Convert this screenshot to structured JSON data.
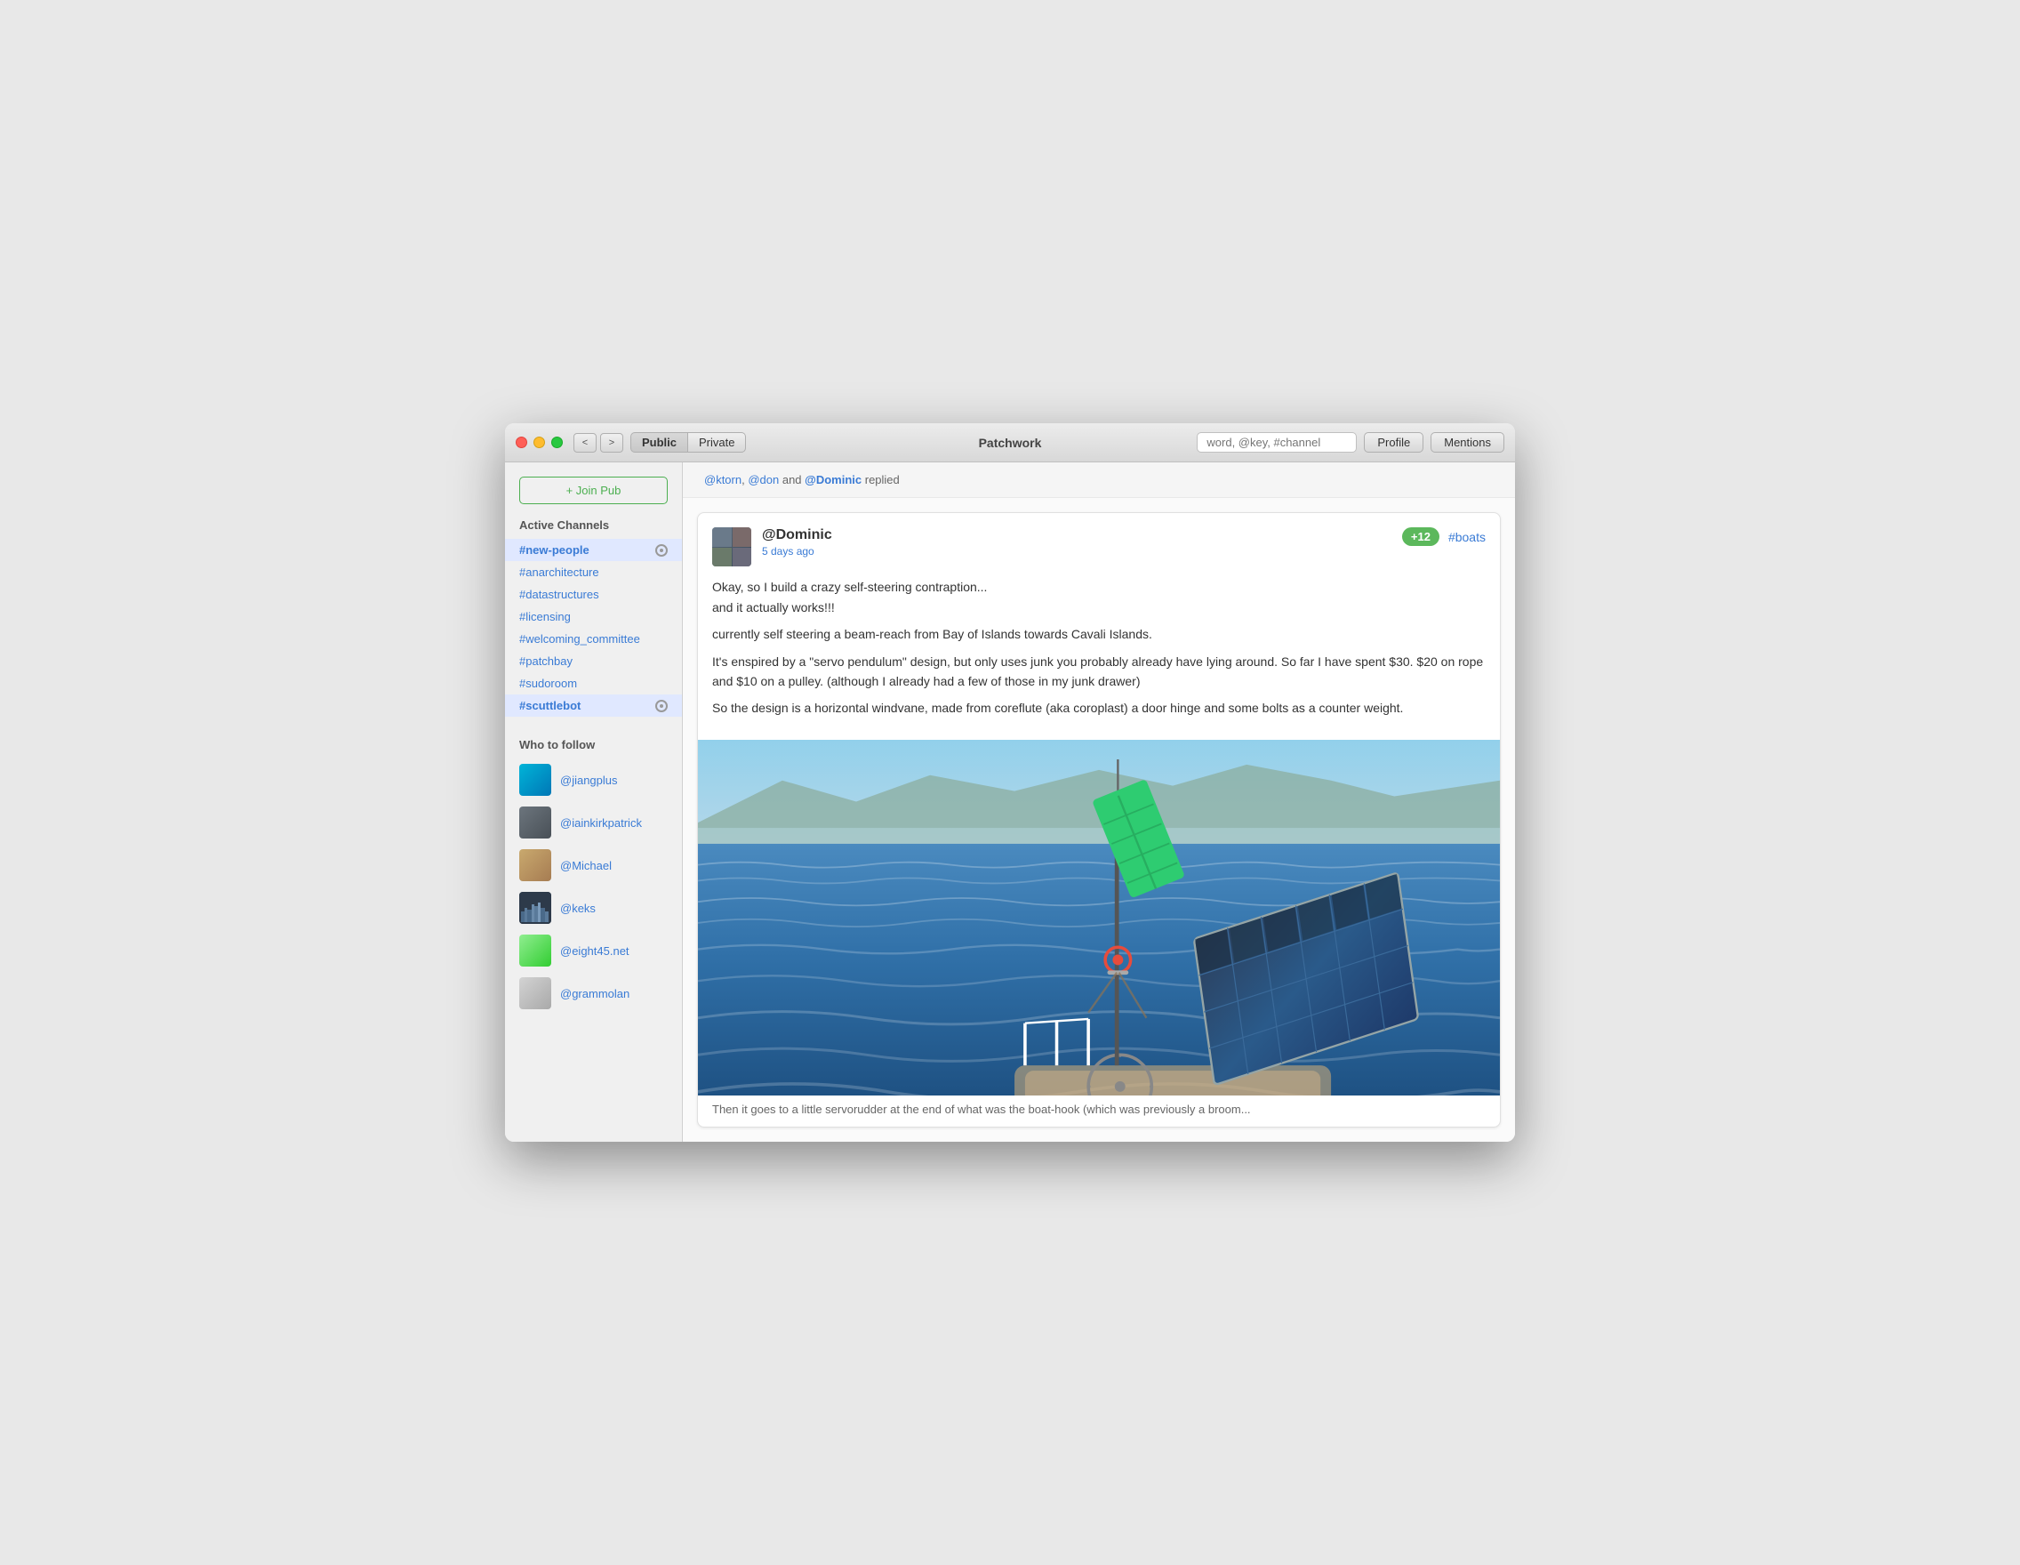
{
  "window": {
    "title": "Patchwork"
  },
  "titlebar": {
    "back_label": "<",
    "forward_label": ">",
    "view_public_label": "Public",
    "view_private_label": "Private",
    "search_placeholder": "word, @key, #channel",
    "profile_label": "Profile",
    "mentions_label": "Mentions"
  },
  "sidebar": {
    "join_pub_label": "+ Join Pub",
    "active_channels_title": "Active Channels",
    "channels": [
      {
        "name": "#new-people",
        "active": true,
        "has_indicator": true
      },
      {
        "name": "#anarchitecture",
        "active": false,
        "has_indicator": false
      },
      {
        "name": "#datastructures",
        "active": false,
        "has_indicator": false
      },
      {
        "name": "#licensing",
        "active": false,
        "has_indicator": false
      },
      {
        "name": "#welcoming_committee",
        "active": false,
        "has_indicator": false
      },
      {
        "name": "#patchbay",
        "active": false,
        "has_indicator": false
      },
      {
        "name": "#sudoroom",
        "active": false,
        "has_indicator": false
      },
      {
        "name": "#scuttlebot",
        "active": true,
        "has_indicator": true
      }
    ],
    "who_to_follow_title": "Who to follow",
    "follow_suggestions": [
      {
        "handle": "@jiangplus",
        "avatar_class": "av-jiangplus"
      },
      {
        "handle": "@iainkirkpatrick",
        "avatar_class": "av-iainkirkpatrick"
      },
      {
        "handle": "@Michael",
        "avatar_class": "av-michael"
      },
      {
        "handle": "@keks",
        "avatar_class": "av-keks"
      },
      {
        "handle": "@eight45.net",
        "avatar_class": "av-eight45"
      },
      {
        "handle": "@grammolan",
        "avatar_class": "av-grammolan"
      }
    ]
  },
  "main": {
    "replied_notice": {
      "text": "@ktorn, @don and @Dominic replied",
      "mentions": [
        "@ktorn",
        "@don",
        "@Dominic"
      ]
    },
    "post": {
      "author": "@Dominic",
      "time": "5 days ago",
      "reaction": "+12",
      "channel_tag": "#boats",
      "body_paragraphs": [
        "Okay, so I build a crazy self-steering contraption...\nand it actually works!!!",
        "currently self steering a beam-reach from Bay of Islands towards Cavali Islands.",
        "It's enspired by a \"servo pendulum\" design, but only uses junk you probably already have lying around. So far I have spent $30. $20 on rope and $10 on a pulley. (although I already had a few of those in my junk drawer)",
        "So the design is a horizontal windvane, made from coreflute (aka coroplast) a door hinge and some bolts as a counter weight.",
        "Then it goes to a little servorudder at the end of what was the boat-hook (which was previously a broom..."
      ]
    }
  }
}
